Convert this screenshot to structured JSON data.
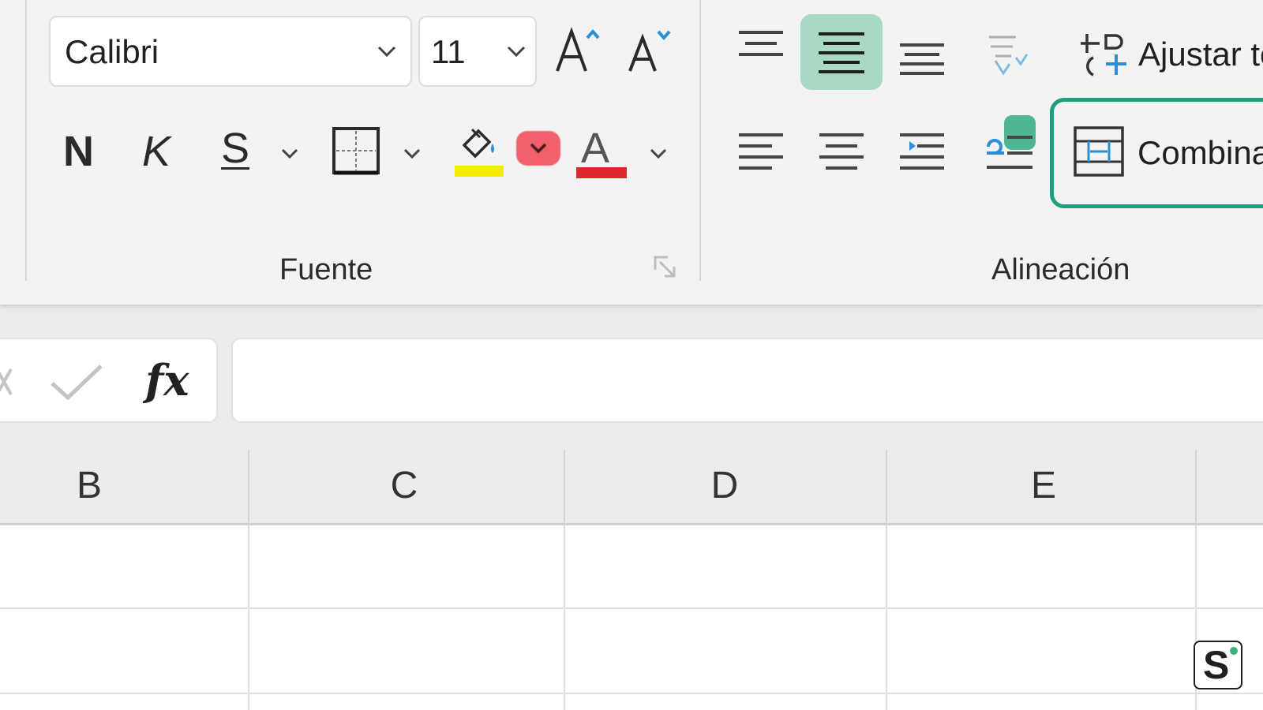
{
  "ribbon": {
    "font": {
      "name": "Calibri",
      "size": "11",
      "bold_label": "N",
      "italic_label": "K",
      "underline_label": "S",
      "font_color_label": "A",
      "group_label": "Fuente",
      "highlight_color": "#f2ec00",
      "font_color": "#e0262d"
    },
    "alignment": {
      "wrap_text_label": "Ajustar te",
      "merge_label": "Combina",
      "group_label": "Alineación",
      "accent": "#1f9e7f"
    }
  },
  "formula_bar": {
    "fx_label": "fx",
    "value": ""
  },
  "grid": {
    "columns": [
      "B",
      "C",
      "D",
      "E"
    ]
  },
  "watermark": {
    "letter": "S"
  }
}
